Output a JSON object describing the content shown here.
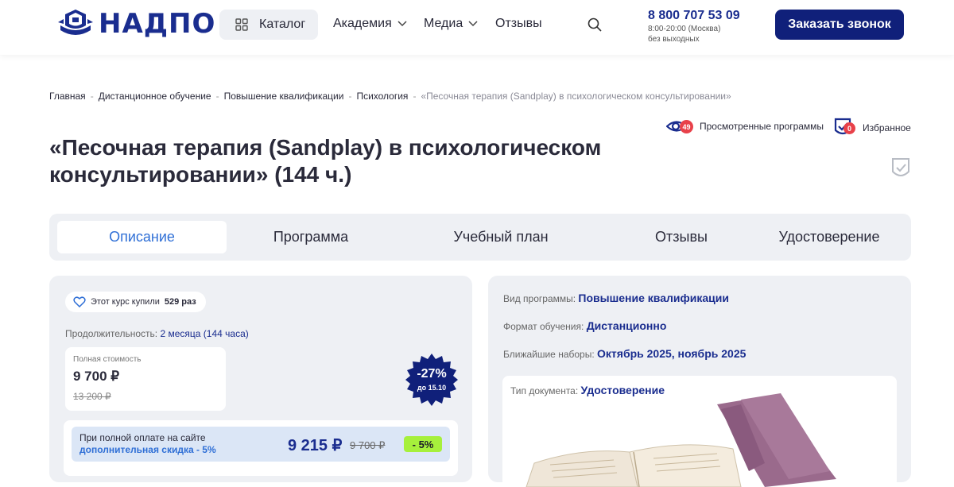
{
  "brand": {
    "name": "НАДПО"
  },
  "header": {
    "catalog_label": "Каталог",
    "nav": [
      {
        "label": "Академия",
        "has_dropdown": true
      },
      {
        "label": "Медиа",
        "has_dropdown": true
      },
      {
        "label": "Отзывы",
        "has_dropdown": false
      }
    ],
    "phone": "8 800 707 53 09",
    "hours": "8:00-20:00 (Москва)",
    "days": "без выходных",
    "call_button": "Заказать звонок"
  },
  "breadcrumb": [
    "Главная",
    "Дистанционное обучение",
    "Повышение квалификации",
    "Психология",
    "«Песочная терапия (Sandplay) в психологическом консультировании»"
  ],
  "user_links": {
    "viewed_label": "Просмотренные программы",
    "viewed_count": "49",
    "favorites_label": "Избранное",
    "favorites_count": "0"
  },
  "page_title": "«Песочная терапия (Sandplay) в психологическом консультировании» (144 ч.)",
  "tabs": [
    {
      "label": "Описание",
      "active": true
    },
    {
      "label": "Программа",
      "active": false
    },
    {
      "label": "Учебный план",
      "active": false
    },
    {
      "label": "Отзывы",
      "active": false
    },
    {
      "label": "Удостоверение",
      "active": false
    }
  ],
  "pricing": {
    "bought_prefix": "Этот курс купили",
    "bought_count": "529 раз",
    "duration_label": "Продолжительность:",
    "duration_value": "2 месяца (144 часа)",
    "full_price_label": "Полная стоимость",
    "price_now": "9 700 ₽",
    "price_old": "13 200 ₽",
    "discount_pct": "-27%",
    "discount_until": "до 15.10",
    "extra_line1": "При полной оплате на сайте",
    "extra_line2": "дополнительная скидка - 5%",
    "final_price": "9 215 ₽",
    "final_old": "9 700 ₽",
    "extra_pct": "- 5%"
  },
  "program_info": {
    "type_label": "Вид программы:",
    "type_value": "Повышение квалификации",
    "format_label": "Формат обучения:",
    "format_value": "Дистанционно",
    "enroll_label": "Ближайшие наборы:",
    "enroll_value": "Октябрь 2025, ноябрь 2025",
    "doc_label": "Тип документа:",
    "doc_value": "Удостоверение"
  },
  "colors": {
    "brand_blue": "#1a2d8f",
    "accent_blue": "#2f6fd6",
    "button_navy": "#10207a",
    "badge_red": "#e8414a",
    "discount_green": "#a6f03c"
  }
}
